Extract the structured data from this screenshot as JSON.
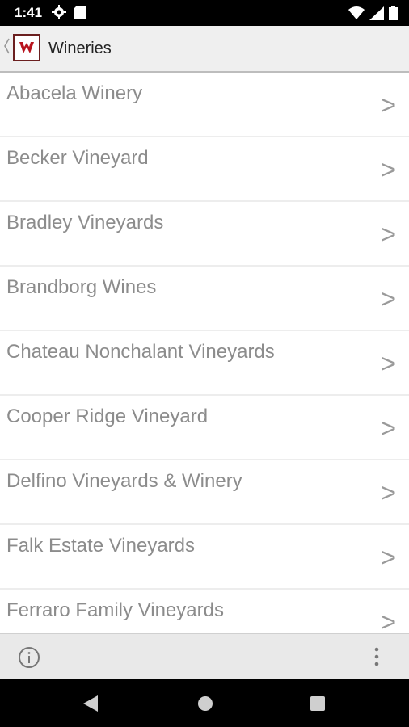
{
  "status_bar": {
    "time": "1:41"
  },
  "app_bar": {
    "title": "Wineries"
  },
  "wineries": [
    "Abacela Winery",
    "Becker Vineyard",
    "Bradley Vineyards",
    "Brandborg Wines",
    "Chateau Nonchalant Vineyards",
    "Cooper Ridge Vineyard",
    "Delfino Vineyards & Winery",
    "Falk Estate Vineyards",
    "Ferraro Family Vineyards"
  ],
  "chevron_glyph": ">",
  "icons": {
    "status": [
      "gear-icon",
      "sd-card-icon",
      "wifi-icon",
      "signal-icon",
      "battery-icon"
    ],
    "app_bar": [
      "back-chevron-icon",
      "winery-logo-icon"
    ],
    "bottom_bar": [
      "info-icon",
      "overflow-menu-icon"
    ],
    "nav": [
      "nav-back-icon",
      "nav-home-icon",
      "nav-recents-icon"
    ]
  }
}
